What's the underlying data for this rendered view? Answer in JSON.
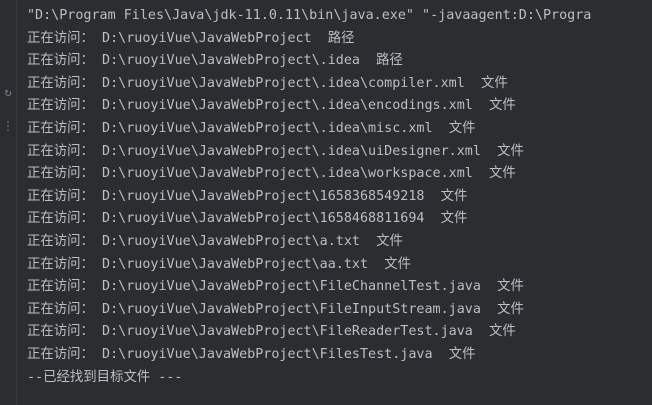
{
  "console": {
    "command": "\"D:\\Program Files\\Java\\jdk-11.0.11\\bin\\java.exe\" \"-javaagent:D:\\Progra",
    "label": "正在访问：",
    "entries": [
      {
        "path": "D:\\ruoyiVue\\JavaWebProject",
        "kind": "路径"
      },
      {
        "path": "D:\\ruoyiVue\\JavaWebProject\\.idea",
        "kind": "路径"
      },
      {
        "path": "D:\\ruoyiVue\\JavaWebProject\\.idea\\compiler.xml",
        "kind": "文件"
      },
      {
        "path": "D:\\ruoyiVue\\JavaWebProject\\.idea\\encodings.xml",
        "kind": "文件"
      },
      {
        "path": "D:\\ruoyiVue\\JavaWebProject\\.idea\\misc.xml",
        "kind": "文件"
      },
      {
        "path": "D:\\ruoyiVue\\JavaWebProject\\.idea\\uiDesigner.xml",
        "kind": "文件"
      },
      {
        "path": "D:\\ruoyiVue\\JavaWebProject\\.idea\\workspace.xml",
        "kind": "文件"
      },
      {
        "path": "D:\\ruoyiVue\\JavaWebProject\\1658368549218",
        "kind": "文件"
      },
      {
        "path": "D:\\ruoyiVue\\JavaWebProject\\1658468811694",
        "kind": "文件"
      },
      {
        "path": "D:\\ruoyiVue\\JavaWebProject\\a.txt",
        "kind": "文件"
      },
      {
        "path": "D:\\ruoyiVue\\JavaWebProject\\aa.txt",
        "kind": "文件"
      },
      {
        "path": "D:\\ruoyiVue\\JavaWebProject\\FileChannelTest.java",
        "kind": "文件"
      },
      {
        "path": "D:\\ruoyiVue\\JavaWebProject\\FileInputStream.java",
        "kind": "文件"
      },
      {
        "path": "D:\\ruoyiVue\\JavaWebProject\\FileReaderTest.java",
        "kind": "文件"
      },
      {
        "path": "D:\\ruoyiVue\\JavaWebProject\\FilesTest.java",
        "kind": "文件"
      }
    ],
    "footer": "--已经找到目标文件 ---"
  },
  "gutter": {
    "icons": [
      "rerun-icon",
      "scroll-icon"
    ]
  },
  "colors": {
    "background": "#2b2d30",
    "text": "#bcbec4"
  }
}
